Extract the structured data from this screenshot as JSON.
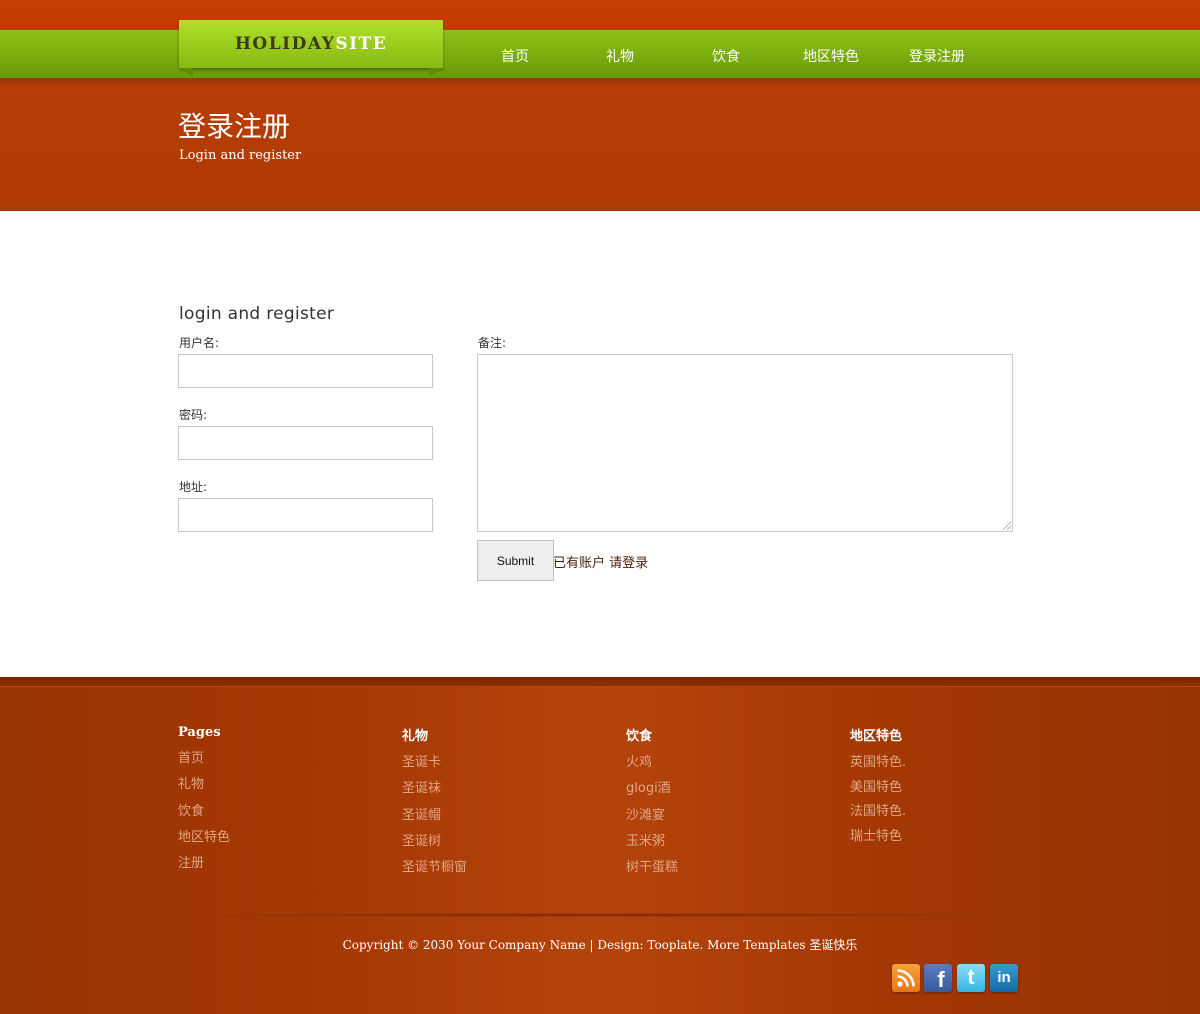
{
  "header": {
    "logo_part1": "HOLIDAY",
    "logo_part2": "SITE",
    "nav": [
      "首页",
      "礼物",
      "饮食",
      "地区特色",
      "登录注册"
    ]
  },
  "banner": {
    "title": "登录注册",
    "subtitle": "Login and register"
  },
  "form": {
    "heading": "login and register",
    "username_label": "用户名:",
    "username_value": "",
    "password_label": "密码:",
    "password_value": "",
    "address_label": "地址:",
    "address_value": "",
    "notes_label": "备注:",
    "notes_value": "",
    "submit_label": "Submit",
    "login_link": "已有账户 请登录"
  },
  "footer": {
    "columns": [
      {
        "title": "Pages",
        "links": [
          "首页",
          "礼物",
          "饮食",
          "地区特色",
          "注册"
        ]
      },
      {
        "title": "礼物",
        "links": [
          "圣诞卡",
          "圣诞袜",
          "圣诞帽",
          "圣诞树",
          "圣诞节橱窗"
        ]
      },
      {
        "title": "饮食",
        "links": [
          "火鸡",
          "glogi酒",
          "沙滩宴",
          "玉米粥",
          "树干蛋糕"
        ]
      },
      {
        "title": "地区特色",
        "links": [
          "英国特色.",
          "美国特色",
          "法国特色.",
          "瑞士特色"
        ]
      }
    ],
    "copyright": "Copyright © 2030 Your Company Name | Design: Tooplate. More Templates 圣诞快乐",
    "social": [
      "rss-icon",
      "facebook-icon",
      "twitter-icon",
      "linkedin-icon"
    ]
  },
  "colors": {
    "header_orange": "#c43e05",
    "nav_green": "#7aac10",
    "banner_rust": "#b03a04",
    "footer_rust": "#a63905",
    "footer_link": "#e0a584"
  }
}
